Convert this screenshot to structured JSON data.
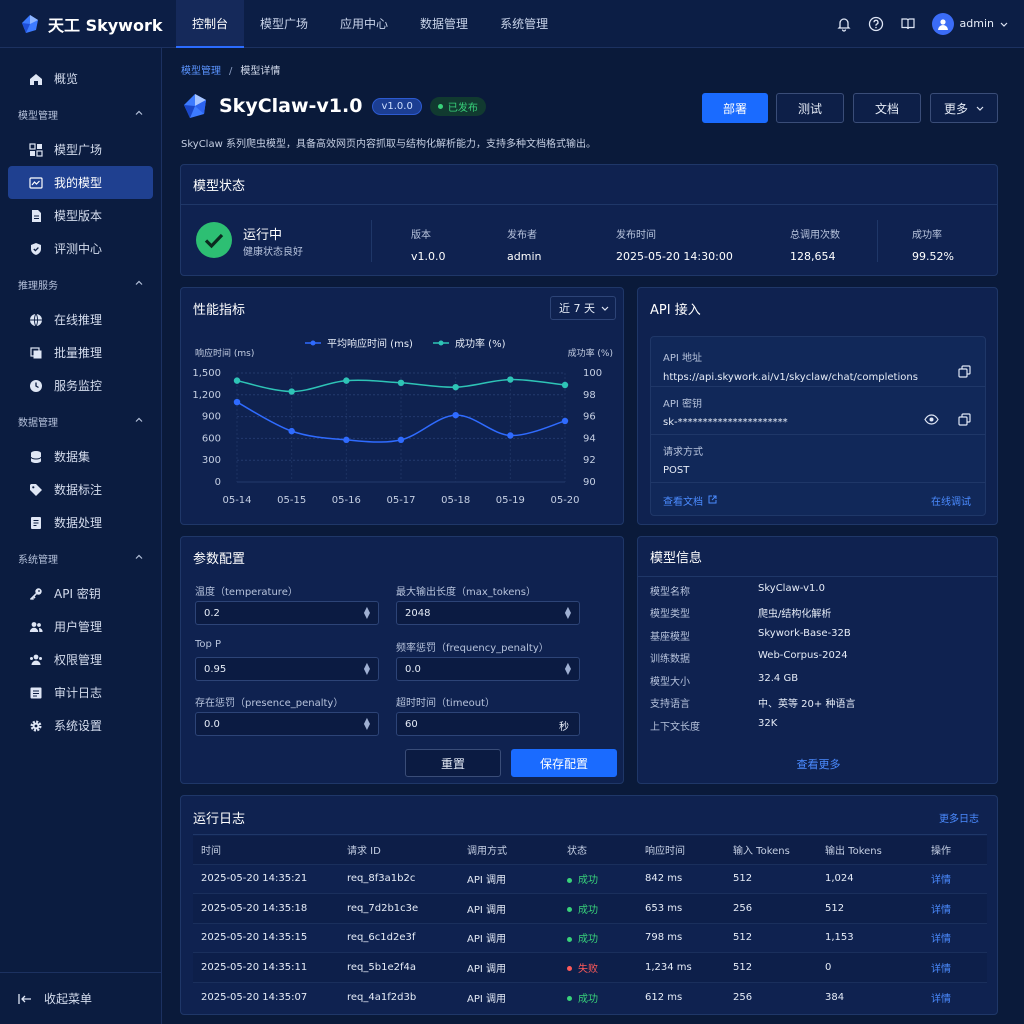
{
  "app": {
    "name": "天工 Skywork"
  },
  "topnav": {
    "items": [
      "控制台",
      "模型广场",
      "应用中心",
      "数据管理",
      "系统管理"
    ],
    "active": 0
  },
  "user": {
    "name": "admin"
  },
  "sidebar": {
    "overview": "概览",
    "groups": [
      {
        "title": "模型管理",
        "items": [
          "模型广场",
          "我的模型",
          "模型版本",
          "评测中心"
        ]
      },
      {
        "title": "推理服务",
        "items": [
          "在线推理",
          "批量推理",
          "服务监控"
        ]
      },
      {
        "title": "数据管理",
        "items": [
          "数据集",
          "数据标注",
          "数据处理"
        ]
      },
      {
        "title": "系统管理",
        "items": [
          "API 密钥",
          "用户管理",
          "权限管理",
          "审计日志",
          "系统设置"
        ]
      }
    ],
    "active": "我的模型",
    "collapse": "收起菜单"
  },
  "breadcrumb": {
    "parent": "模型管理",
    "sep": "/",
    "current": "模型详情"
  },
  "model": {
    "title": "SkyClaw-v1.0",
    "version_badge": "v1.0.0",
    "status_badge": "已发布",
    "description": "SkyClaw 系列爬虫模型，具备高效网页内容抓取与结构化解析能力，支持多种文档格式输出。"
  },
  "actions": {
    "deploy": "部署",
    "test": "测试",
    "docs": "文档",
    "more": "更多"
  },
  "status_card": {
    "title": "模型状态",
    "state": "运行中",
    "health": "健康状态良好",
    "stats": [
      {
        "label": "版本",
        "value": "v1.0.0"
      },
      {
        "label": "发布者",
        "value": "admin"
      },
      {
        "label": "发布时间",
        "value": "2025-05-20 14:30:00"
      },
      {
        "label": "总调用次数",
        "value": "128,654"
      },
      {
        "label": "成功率",
        "value": "99.52%"
      }
    ]
  },
  "perf": {
    "title": "性能指标",
    "range": "近 7 天",
    "colors": {
      "response": "#2f6bff",
      "success": "#2ec4b6"
    }
  },
  "chart_data": {
    "type": "line",
    "categories": [
      "05-14",
      "05-15",
      "05-16",
      "05-17",
      "05-18",
      "05-19",
      "05-20"
    ],
    "series": [
      {
        "name": "平均响应时间 (ms)",
        "axis": "left",
        "values": [
          1100,
          700,
          580,
          580,
          920,
          640,
          840
        ]
      },
      {
        "name": "成功率 (%)",
        "axis": "right",
        "values": [
          99.3,
          98.3,
          99.3,
          99.1,
          98.7,
          99.4,
          98.9
        ]
      }
    ],
    "ylabel": "响应时间 (ms)",
    "ylabel_right": "成功率 (%)",
    "ylim": [
      0,
      1500
    ],
    "ylim_right": [
      90,
      100
    ],
    "yticks": [
      "1,500",
      "1,200",
      "900",
      "600",
      "300",
      "0"
    ],
    "yticks_right": [
      "100",
      "98",
      "96",
      "94",
      "92",
      "90"
    ],
    "grid": true,
    "legend": "top"
  },
  "api": {
    "title": "API 接入",
    "url_label": "API 地址",
    "url": "https://api.skywork.ai/v1/skyclaw/chat/completions",
    "key_label": "API 密钥",
    "key": "sk-**********************",
    "method_label": "请求方式",
    "method": "POST",
    "docs_link": "查看文档",
    "debug_link": "在线调试"
  },
  "params": {
    "title": "参数配置",
    "fields": [
      {
        "label": "温度（temperature）",
        "value": "0.2"
      },
      {
        "label": "最大输出长度（max_tokens）",
        "value": "2048"
      },
      {
        "label": "Top P",
        "value": "0.95"
      },
      {
        "label": "频率惩罚（frequency_penalty）",
        "value": "0.0"
      },
      {
        "label": "存在惩罚（presence_penalty）",
        "value": "0.0"
      },
      {
        "label": "超时时间（timeout）",
        "value": "60",
        "unit": "秒"
      }
    ],
    "reset": "重置",
    "save": "保存配置"
  },
  "info": {
    "title": "模型信息",
    "rows": [
      {
        "k": "模型名称",
        "v": "SkyClaw-v1.0"
      },
      {
        "k": "模型类型",
        "v": "爬虫/结构化解析"
      },
      {
        "k": "基座模型",
        "v": "Skywork-Base-32B"
      },
      {
        "k": "训练数据",
        "v": "Web-Corpus-2024"
      },
      {
        "k": "模型大小",
        "v": "32.4 GB"
      },
      {
        "k": "支持语言",
        "v": "中、英等 20+ 种语言"
      },
      {
        "k": "上下文长度",
        "v": "32K"
      }
    ],
    "more": "查看更多"
  },
  "logs": {
    "title": "运行日志",
    "more": "更多日志",
    "columns": [
      "时间",
      "请求 ID",
      "调用方式",
      "状态",
      "响应时间",
      "输入 Tokens",
      "输出 Tokens",
      "操作"
    ],
    "rows": [
      {
        "time": "2025-05-20 14:35:21",
        "id": "req_8f3a1b2c",
        "method": "API 调用",
        "status": "成功",
        "ok": true,
        "rt": "842 ms",
        "in": "512",
        "out": "1,024",
        "op": "详情"
      },
      {
        "time": "2025-05-20 14:35:18",
        "id": "req_7d2b1c3e",
        "method": "API 调用",
        "status": "成功",
        "ok": true,
        "rt": "653 ms",
        "in": "256",
        "out": "512",
        "op": "详情"
      },
      {
        "time": "2025-05-20 14:35:15",
        "id": "req_6c1d2e3f",
        "method": "API 调用",
        "status": "成功",
        "ok": true,
        "rt": "798 ms",
        "in": "512",
        "out": "1,153",
        "op": "详情"
      },
      {
        "time": "2025-05-20 14:35:11",
        "id": "req_5b1e2f4a",
        "method": "API 调用",
        "status": "失败",
        "ok": false,
        "rt": "1,234 ms",
        "in": "512",
        "out": "0",
        "op": "详情"
      },
      {
        "time": "2025-05-20 14:35:07",
        "id": "req_4a1f2d3b",
        "method": "API 调用",
        "status": "成功",
        "ok": true,
        "rt": "612 ms",
        "in": "256",
        "out": "384",
        "op": "详情"
      }
    ]
  }
}
